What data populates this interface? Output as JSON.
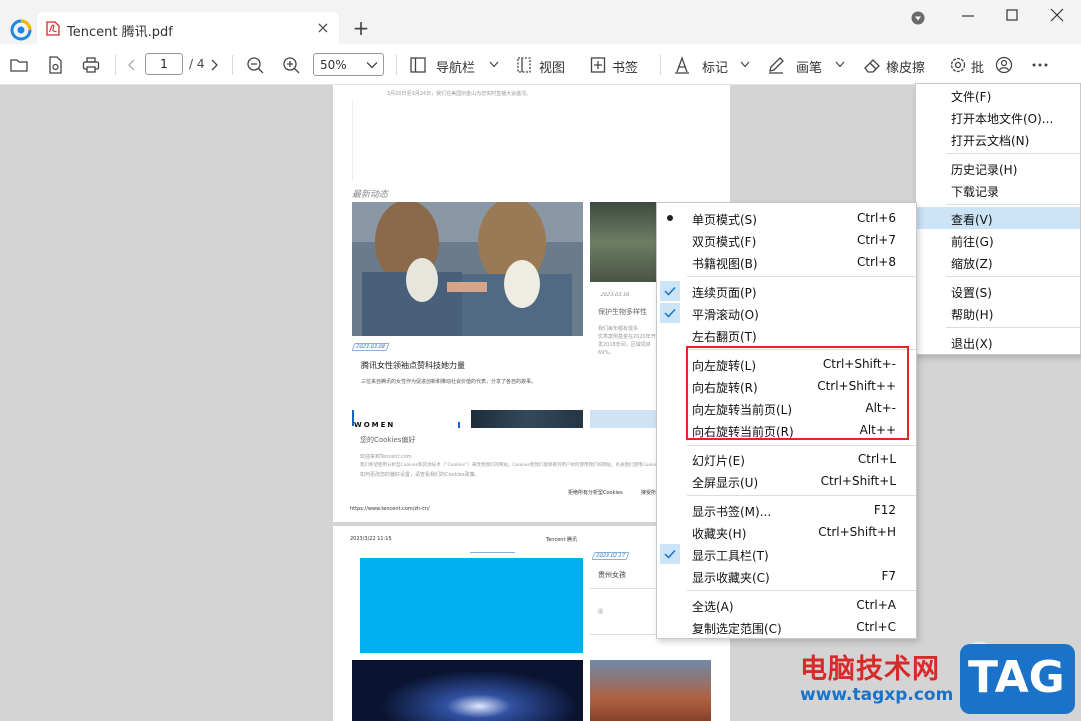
{
  "window": {
    "tab_title": "Tencent 腾讯.pdf"
  },
  "toolbar": {
    "page_current": "1",
    "page_total": "/ 4",
    "zoom": "50%",
    "nav_label": "导航栏",
    "view_label": "视图",
    "bookmark_label": "书签",
    "mark_label": "标记",
    "pen_label": "画笔",
    "eraser_label": "橡皮擦",
    "batch_label": "批"
  },
  "document": {
    "top_line": "3月20日至3月24日，我们在美国旧金山为您实时直播大会盛况。",
    "section_title": "最新动态",
    "card1_date": "2023.03.08",
    "card1_title": "腾讯女性领袖点赞科技她力量",
    "card1_desc": "三位来自腾讯的女性作为促进创新和推动社会价值的代表，分享了各自的故事。",
    "card2_date": "2023.03.16",
    "card2_title": "保护生物多样性",
    "card2_desc_1": "我们每年都有很多",
    "card2_desc_2": "优秀案例基金在2020年开",
    "card2_desc_3": "发2018年间，区域项目",
    "card2_desc_4": "69%。",
    "women": "WOMEN",
    "cookie_title": "您的Cookies偏好",
    "cookie_l1": "欢迎来到Tencent.com",
    "cookie_l2": "我们希望使用分析型Cookies和其他技术（“Cookies”）来改善我们的网站。Cookies使我们能够看到用户如何使用我们的网站。有关我们使用Cookies的更多详情，",
    "cookie_l3": "如何更改您的偏好设置，请查看我们的Cookies政策。",
    "cookie_reject": "拒绝所有分析型Cookies",
    "cookie_accept": "接受所有",
    "footer_url": "https://www.tencent.com/zh-cn/",
    "p2_date": "2023/3/22 11:15",
    "p2_header": "Tencent 腾讯",
    "p2_tag": "2023.02.17",
    "p2_title": "贵州女孩",
    "p2_small": "提"
  },
  "file_menu": {
    "items": [
      {
        "label": "文件(F)"
      },
      {
        "label": "打开本地文件(O)..."
      },
      {
        "label": "打开云文档(N)"
      },
      {
        "label": "历史记录(H)"
      },
      {
        "label": "下载记录"
      },
      {
        "label": "查看(V)"
      },
      {
        "label": "前往(G)"
      },
      {
        "label": "缩放(Z)"
      },
      {
        "label": "设置(S)"
      },
      {
        "label": "帮助(H)"
      },
      {
        "label": "退出(X)"
      }
    ]
  },
  "view_menu": {
    "items": [
      {
        "label": "单页模式(S)",
        "shortcut": "Ctrl+6"
      },
      {
        "label": "双页模式(F)",
        "shortcut": "Ctrl+7"
      },
      {
        "label": "书籍视图(B)",
        "shortcut": "Ctrl+8"
      },
      {
        "label": "连续页面(P)",
        "shortcut": ""
      },
      {
        "label": "平滑滚动(O)",
        "shortcut": ""
      },
      {
        "label": "左右翻页(T)",
        "shortcut": ""
      },
      {
        "label": "向左旋转(L)",
        "shortcut": "Ctrl+Shift+-"
      },
      {
        "label": "向右旋转(R)",
        "shortcut": "Ctrl+Shift++"
      },
      {
        "label": "向左旋转当前页(L)",
        "shortcut": "Alt+-"
      },
      {
        "label": "向右旋转当前页(R)",
        "shortcut": "Alt++"
      },
      {
        "label": "幻灯片(E)",
        "shortcut": "Ctrl+L"
      },
      {
        "label": "全屏显示(U)",
        "shortcut": "Ctrl+Shift+L"
      },
      {
        "label": "显示书签(M)...",
        "shortcut": "F12"
      },
      {
        "label": "收藏夹(H)",
        "shortcut": "Ctrl+Shift+H"
      },
      {
        "label": "显示工具栏(T)",
        "shortcut": ""
      },
      {
        "label": "显示收藏夹(C)",
        "shortcut": "F7"
      },
      {
        "label": "全选(A)",
        "shortcut": "Ctrl+A"
      },
      {
        "label": "复制选定范围(C)",
        "shortcut": "Ctrl+C"
      }
    ]
  },
  "watermark": {
    "cn": "电脑技术网",
    "url": "www.tagxp.com",
    "tag": "TAG"
  },
  "colors": {
    "highlight": "#cce4f7",
    "annotation_red": "#e52424",
    "pdf_red": "#d62b2b"
  }
}
